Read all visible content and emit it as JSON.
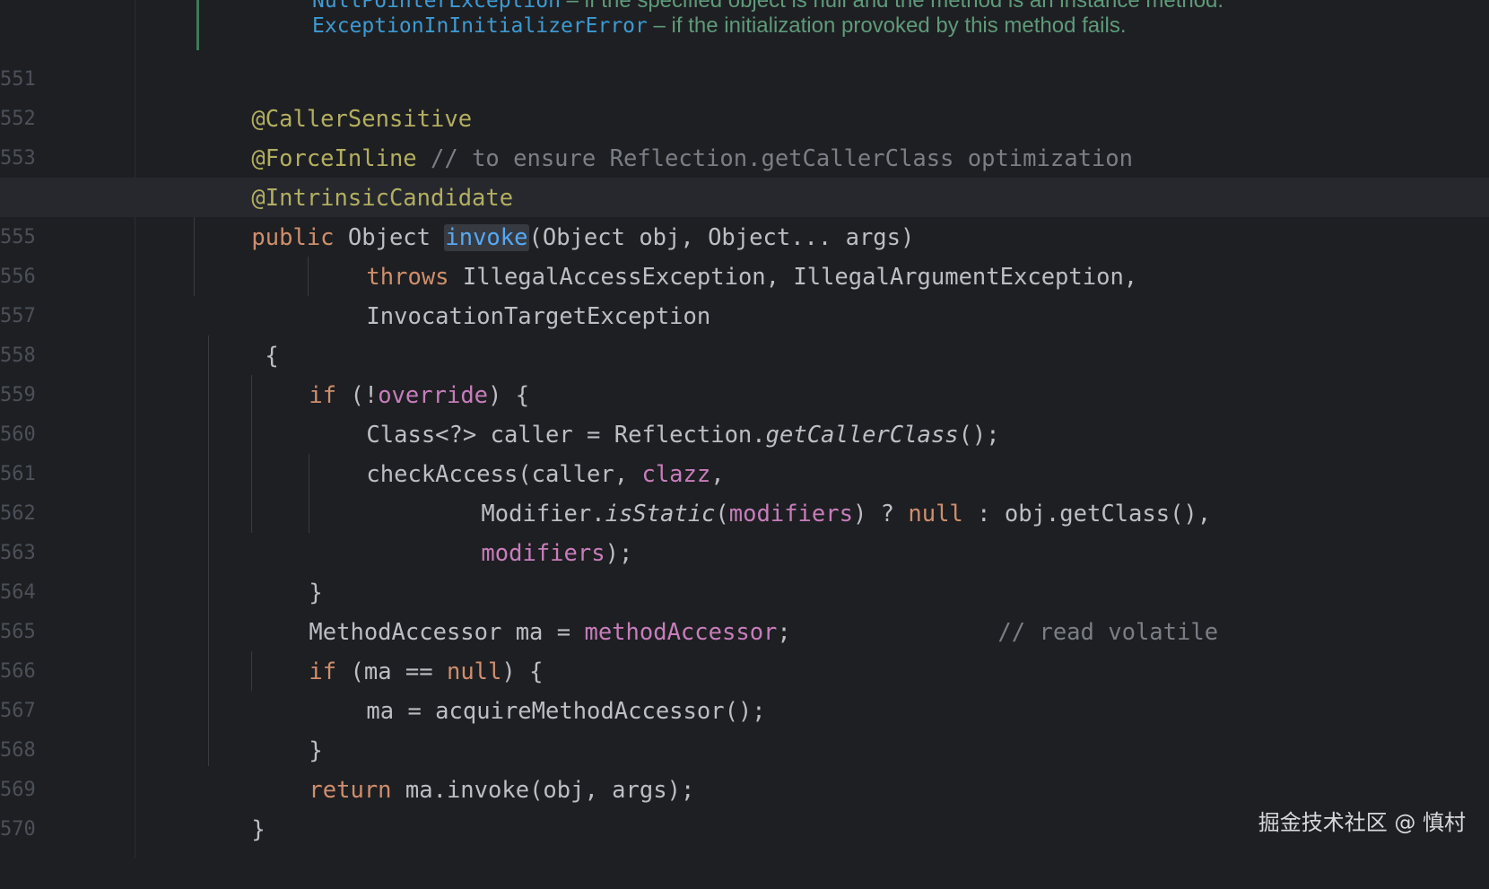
{
  "editor": {
    "doc_tail": {
      "line1_code": "NullPointerException",
      "line1_text": " – if the specified object is null and the method is an instance method.",
      "line2_code": "ExceptionInInitializerError",
      "line2_text": " – if the initialization provoked by this method fails."
    },
    "line_numbers": [
      "551",
      "552",
      "553",
      "554",
      "555",
      "556",
      "557",
      "558",
      "559",
      "560",
      "561",
      "562",
      "563",
      "564",
      "565",
      "566",
      "567",
      "568",
      "569",
      "570"
    ],
    "code": {
      "l551": {
        "a": "@CallerSensitive"
      },
      "l552": {
        "a": "@ForceInline",
        "b": " // to ensure Reflection.getCallerClass optimization"
      },
      "l553": {
        "a": "@IntrinsicCandidate"
      },
      "l554": {
        "a": "public",
        "b": " Object ",
        "c": "invoke",
        "d": "(Object obj, Object... args)"
      },
      "l555": {
        "a": "throws",
        "b": " IllegalAccessException, IllegalArgumentException,"
      },
      "l556": {
        "a": "InvocationTargetException"
      },
      "l557": {
        "a": "{"
      },
      "l558": {
        "a": "if",
        "b": " (!",
        "c": "override",
        "d": ") {"
      },
      "l559": {
        "a": "Class<?> caller = Reflection.",
        "b": "getCallerClass",
        "c": "();"
      },
      "l560": {
        "a": "checkAccess(caller, ",
        "b": "clazz",
        "c": ","
      },
      "l561": {
        "a": "Modifier.",
        "b": "isStatic",
        "c": "(",
        "d": "modifiers",
        "e": ") ? ",
        "f": "null",
        "g": " : obj.getClass(),"
      },
      "l562": {
        "a": "modifiers",
        "b": ");"
      },
      "l563": {
        "a": "}"
      },
      "l564": {
        "a": "MethodAccessor ma = ",
        "b": "methodAccessor",
        "c": ";",
        "d": "// read volatile"
      },
      "l565": {
        "a": "if",
        "b": " (ma == ",
        "c": "null",
        "d": ") {"
      },
      "l566": {
        "a": "ma = acquireMethodAccessor();"
      },
      "l567": {
        "a": "}"
      },
      "l568": {
        "a": "return",
        "b": " ma.invoke(obj, args);"
      },
      "l569": {
        "a": "}"
      }
    }
  },
  "watermark": "掘金技术社区 @ 慎村",
  "colors": {
    "background": "#1e1f22",
    "keyword": "#cf8e6d",
    "annotation": "#b3ae60",
    "field": "#c77dbb",
    "comment": "#7a7e85",
    "method_decl": "#56a8f5",
    "doc_text": "#5e9a7a"
  }
}
